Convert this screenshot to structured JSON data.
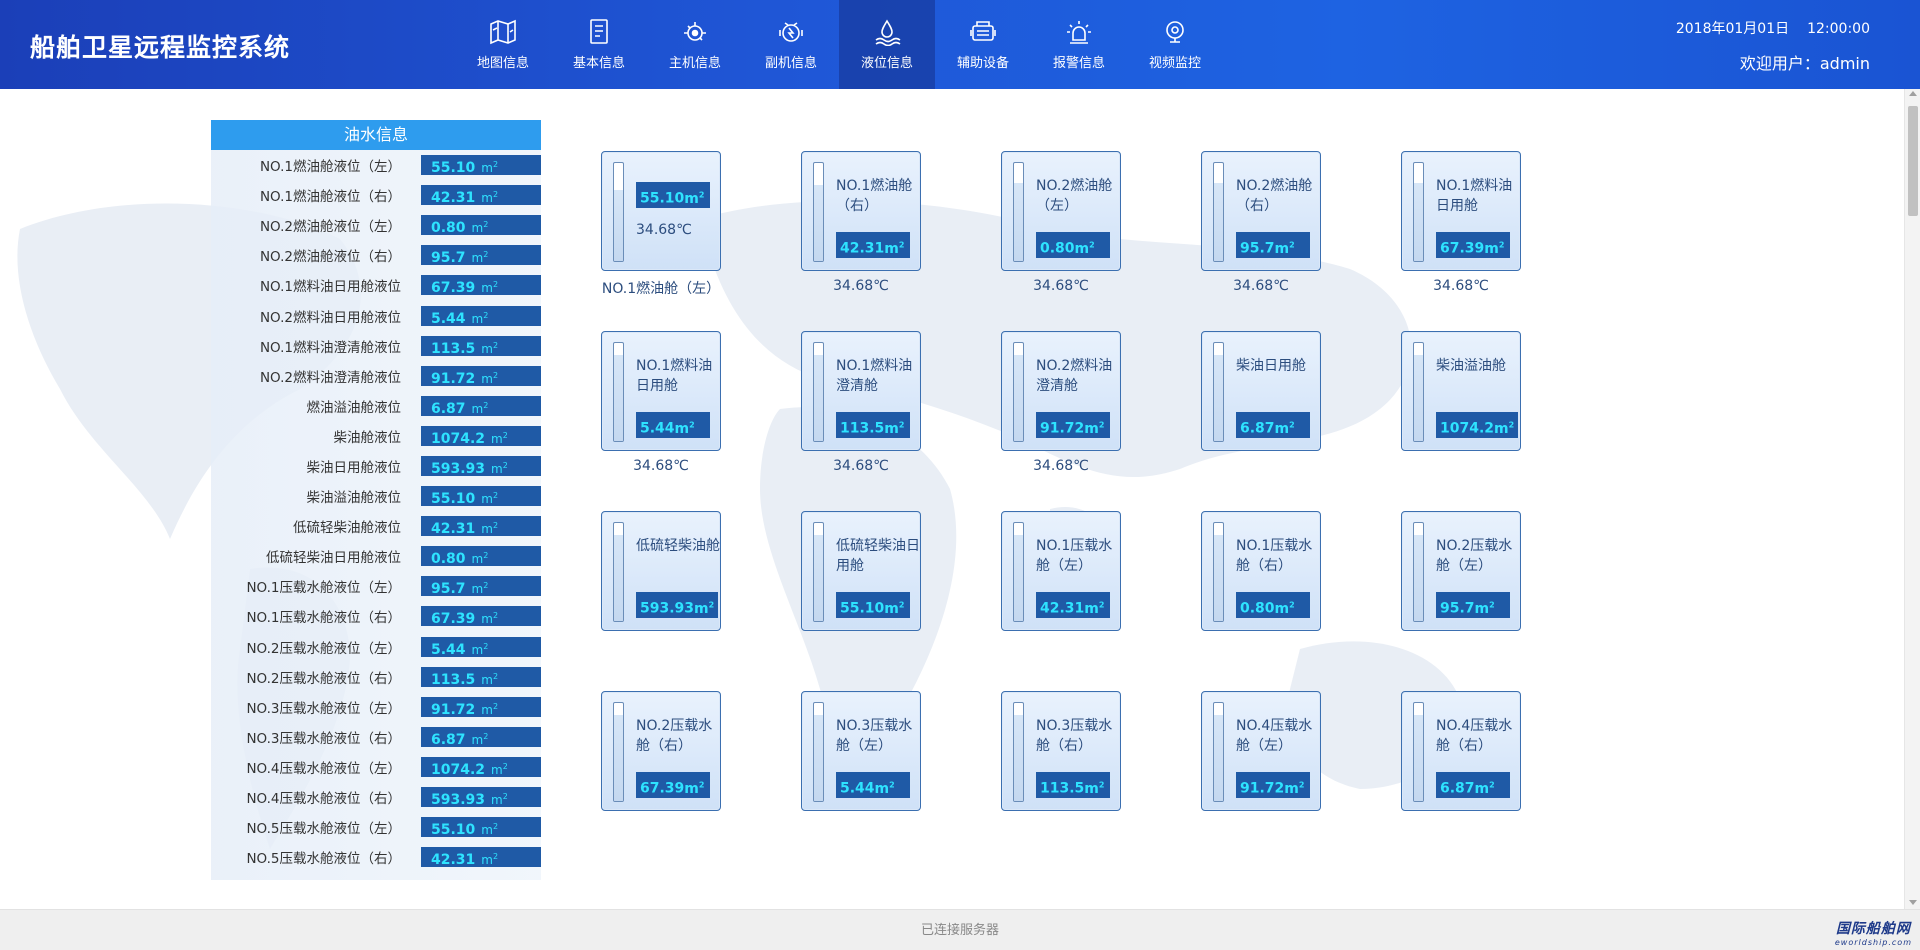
{
  "header": {
    "title": "船舶卫星远程监控系统",
    "date": "2018年01月01日",
    "time": "12:00:00",
    "welcome": "欢迎用户：admin",
    "nav": [
      {
        "label": "地图信息",
        "icon": "map-icon"
      },
      {
        "label": "基本信息",
        "icon": "document-icon"
      },
      {
        "label": "主机信息",
        "icon": "engine-icon"
      },
      {
        "label": "副机信息",
        "icon": "generator-icon"
      },
      {
        "label": "液位信息",
        "icon": "liquid-level-icon",
        "active": true
      },
      {
        "label": "辅助设备",
        "icon": "auxiliary-equipment-icon"
      },
      {
        "label": "报警信息",
        "icon": "alarm-icon"
      },
      {
        "label": "视频监控",
        "icon": "camera-icon"
      }
    ]
  },
  "panel": {
    "title": "油水信息",
    "rows": [
      {
        "label": "NO.1燃油舱液位（左）",
        "value": "55.10"
      },
      {
        "label": "NO.1燃油舱液位（右）",
        "value": "42.31"
      },
      {
        "label": "NO.2燃油舱液位（左）",
        "value": "0.80"
      },
      {
        "label": "NO.2燃油舱液位（右）",
        "value": "95.7"
      },
      {
        "label": "NO.1燃料油日用舱液位",
        "value": "67.39"
      },
      {
        "label": "NO.2燃料油日用舱液位",
        "value": "5.44"
      },
      {
        "label": "NO.1燃料油澄清舱液位",
        "value": "113.5"
      },
      {
        "label": "NO.2燃料油澄清舱液位",
        "value": "91.72"
      },
      {
        "label": "燃油溢油舱液位",
        "value": "6.87"
      },
      {
        "label": "柴油舱液位",
        "value": "1074.2"
      },
      {
        "label": "柴油日用舱液位",
        "value": "593.93"
      },
      {
        "label": "柴油溢油舱液位",
        "value": "55.10"
      },
      {
        "label": "低硫轻柴油舱液位",
        "value": "42.31"
      },
      {
        "label": "低硫轻柴油日用舱液位",
        "value": "0.80"
      },
      {
        "label": "NO.1压载水舱液位（左）",
        "value": "95.7"
      },
      {
        "label": "NO.1压载水舱液位（右）",
        "value": "67.39"
      },
      {
        "label": "NO.2压载水舱液位（左）",
        "value": "5.44"
      },
      {
        "label": "NO.2压载水舱液位（右）",
        "value": "113.5"
      },
      {
        "label": "NO.3压载水舱液位（左）",
        "value": "91.72"
      },
      {
        "label": "NO.3压载水舱液位（右）",
        "value": "6.87"
      },
      {
        "label": "NO.4压载水舱液位（左）",
        "value": "1074.2"
      },
      {
        "label": "NO.4压载水舱液位（右）",
        "value": "593.93"
      },
      {
        "label": "NO.5压载水舱液位（左）",
        "value": "55.10"
      },
      {
        "label": "NO.5压载水舱液位（右）",
        "value": "42.31"
      }
    ]
  },
  "tanks": [
    {
      "name": "",
      "value": "55.10",
      "temp_inside": "34.68℃",
      "caption": "NO.1燃油舱（左）",
      "fill": 0.72
    },
    {
      "name": "NO.1燃油舱（右）",
      "value": "42.31",
      "caption": "34.68℃",
      "fill": 0.78
    },
    {
      "name": "NO.2燃油舱（左）",
      "value": "0.80",
      "caption": "34.68℃",
      "fill": 0.8
    },
    {
      "name": "NO.2燃油舱（右）",
      "value": "95.7",
      "caption": "34.68℃",
      "fill": 0.8
    },
    {
      "name": "NO.1燃料油日用舱",
      "value": "67.39",
      "caption": "34.68℃",
      "fill": 0.8
    },
    {
      "name": "NO.1燃料油日用舱",
      "value": "5.44",
      "caption": "34.68℃",
      "fill": 0.88
    },
    {
      "name": "NO.1燃料油澄清舱",
      "value": "113.5",
      "caption": "34.68℃",
      "fill": 0.88
    },
    {
      "name": "NO.2燃料油澄清舱",
      "value": "91.72",
      "caption": "34.68℃",
      "fill": 0.88
    },
    {
      "name": "柴油日用舱",
      "value": "6.87",
      "caption": "",
      "fill": 0.88
    },
    {
      "name": "柴油溢油舱",
      "value": "1074.2",
      "caption": "",
      "fill": 0.88
    },
    {
      "name": "低硫轻柴油舱",
      "value": "593.93",
      "caption": "",
      "fill": 0.88
    },
    {
      "name": "低硫轻柴油日用舱",
      "value": "55.10",
      "caption": "",
      "fill": 0.88
    },
    {
      "name": "NO.1压载水舱（左）",
      "value": "42.31",
      "caption": "",
      "fill": 0.88
    },
    {
      "name": "NO.1压载水舱（右）",
      "value": "0.80",
      "caption": "",
      "fill": 0.88
    },
    {
      "name": "NO.2压载水舱（左）",
      "value": "95.7",
      "caption": "",
      "fill": 0.88
    },
    {
      "name": "NO.2压载水舱（右）",
      "value": "67.39",
      "caption": "",
      "fill": 0.88
    },
    {
      "name": "NO.3压载水舱（左）",
      "value": "5.44",
      "caption": "",
      "fill": 0.88
    },
    {
      "name": "NO.3压载水舱（右）",
      "value": "113.5",
      "caption": "",
      "fill": 0.88
    },
    {
      "name": "NO.4压载水舱（左）",
      "value": "91.72",
      "caption": "",
      "fill": 0.88
    },
    {
      "name": "NO.4压载水舱（右）",
      "value": "6.87",
      "caption": "",
      "fill": 0.88
    }
  ],
  "footer": {
    "status": "已连接服务器",
    "logo_cn": "国际船舶网",
    "logo_en": "eworldship.com"
  },
  "colors": {
    "header_bg": "#1f56d6",
    "panel_title_bg": "#2e9cee",
    "value_bg": "#1f5aa6",
    "value_text": "#2ee3ff"
  }
}
